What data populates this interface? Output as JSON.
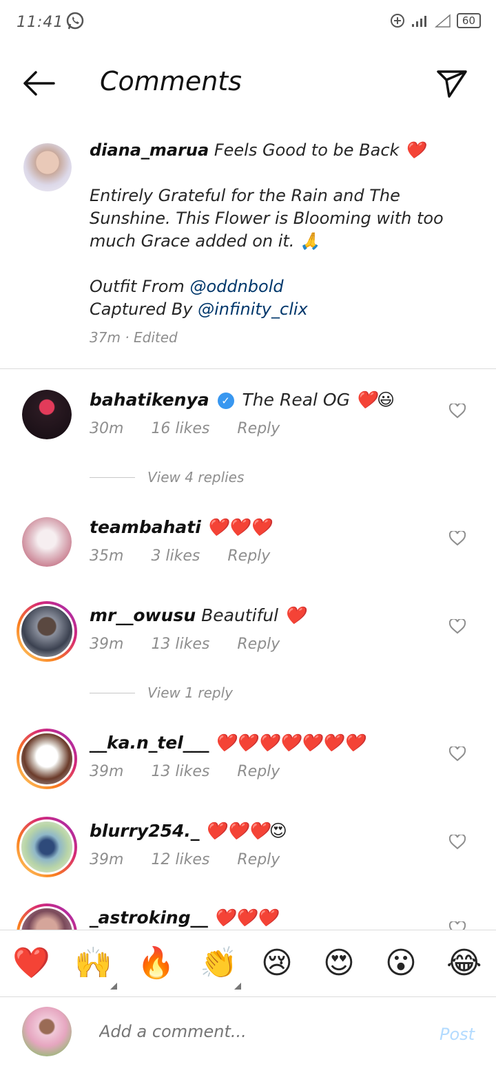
{
  "status": {
    "time": "11:41",
    "battery": "60"
  },
  "header": {
    "title": "Comments"
  },
  "caption": {
    "username": "diana_marua",
    "line1": "Feels Good to be Back ❤️",
    "para2": "Entirely Grateful for the Rain and The Sunshine. This Flower is Blooming with too much Grace added on it. 🙏",
    "outfit_prefix": "Outfit From",
    "outfit_handle": "@oddnbold",
    "captured_prefix": "Captured By",
    "captured_handle": "@infinity_clix",
    "meta": "37m · Edited"
  },
  "comments": [
    {
      "username": "bahatikenya",
      "text": "The Real OG ❤️😃",
      "time": "30m",
      "likes": "16 likes",
      "reply": "Reply"
    },
    {
      "username": "teambahati",
      "text": "❤️❤️❤️",
      "time": "35m",
      "likes": "3 likes",
      "reply": "Reply"
    },
    {
      "username": "mr__owusu",
      "text": "Beautiful ❤️",
      "time": "39m",
      "likes": "13 likes",
      "reply": "Reply"
    },
    {
      "username": "__ka.n_tel___",
      "text": "❤️❤️❤️❤️❤️❤️❤️",
      "time": "39m",
      "likes": "13 likes",
      "reply": "Reply"
    },
    {
      "username": "blurry254._",
      "text": "❤️❤️❤️😍",
      "time": "39m",
      "likes": "12 likes",
      "reply": "Reply"
    },
    {
      "username": "_astroking__",
      "text": "❤️❤️❤️"
    }
  ],
  "view_replies": [
    "View 4 replies",
    "View 1 reply"
  ],
  "emoji_bar": [
    "❤️",
    "🙌",
    "🔥",
    "👏",
    "😢",
    "😍",
    "😮",
    "😂"
  ],
  "composer": {
    "placeholder": "Add a comment...",
    "post_label": "Post"
  },
  "colors": {
    "link": "#00376b",
    "verified": "#3897f0",
    "post_disabled": "#b3dbff",
    "muted": "#8e8e8e"
  }
}
